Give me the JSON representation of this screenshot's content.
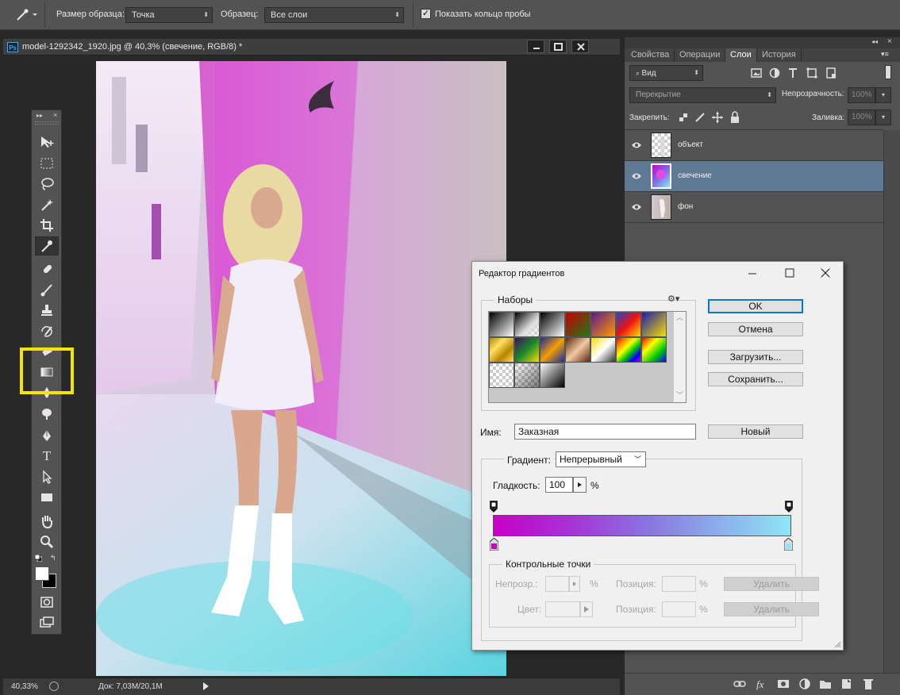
{
  "options_bar": {
    "sample_size_label": "Размер образца:",
    "sample_size_value": "Точка",
    "sample_label": "Образец:",
    "sample_value": "Все слои",
    "show_ring_label": "Показать кольцо пробы",
    "show_ring_checked": true
  },
  "document": {
    "tab_title": "model-1292342_1920.jpg @ 40,3% (свечение, RGB/8) *",
    "ps_badge": "Ps",
    "zoom": "40,33%",
    "doc_info": "Док: 7,03M/20,1M"
  },
  "tools": {
    "highlight_color": "#f5e400",
    "items": [
      "move-tool",
      "marquee-tool",
      "lasso-tool",
      "magic-wand-tool",
      "crop-tool",
      "eyedropper-tool",
      "healing-brush-tool",
      "brush-tool",
      "clone-stamp-tool",
      "history-brush-tool",
      "eraser-tool",
      "gradient-tool",
      "blur-tool",
      "dodge-tool",
      "pen-tool",
      "type-tool",
      "path-selection-tool",
      "rectangle-tool",
      "hand-tool",
      "zoom-tool"
    ],
    "type_glyph": "T"
  },
  "panel": {
    "tabs": [
      "Свойства",
      "Операции",
      "Слои",
      "История"
    ],
    "active_tab": "Слои",
    "kind_filter": "Вид",
    "blend_mode": "Перекрытие",
    "opacity_label": "Непрозрачность:",
    "opacity_value": "100%",
    "lock_label": "Закрепить:",
    "fill_label": "Заливка:",
    "fill_value": "100%",
    "layers": [
      {
        "name": "объект",
        "selected": false
      },
      {
        "name": "свечение",
        "selected": true
      },
      {
        "name": "фон",
        "selected": false
      }
    ],
    "selected_color": "#5f7894"
  },
  "dialog": {
    "title": "Редактор градиентов",
    "presets_label": "Наборы",
    "ok": "OK",
    "cancel": "Отмена",
    "load": "Загрузить...",
    "save": "Сохранить...",
    "name_label": "Имя:",
    "name_value": "Заказная",
    "new_button": "Новый",
    "gradient_type_label": "Градиент:",
    "gradient_type_value": "Непрерывный",
    "smoothness_label": "Гладкость:",
    "smoothness_value": "100",
    "percent": "%",
    "stops_group_label": "Контрольные точки",
    "opacity_stop_label": "Непрозр.:",
    "color_stop_label": "Цвет:",
    "position_label": "Позиция:",
    "delete_button": "Удалить",
    "gradient_start_color": "#c800c8",
    "gradient_end_color": "#8fe6f5"
  }
}
